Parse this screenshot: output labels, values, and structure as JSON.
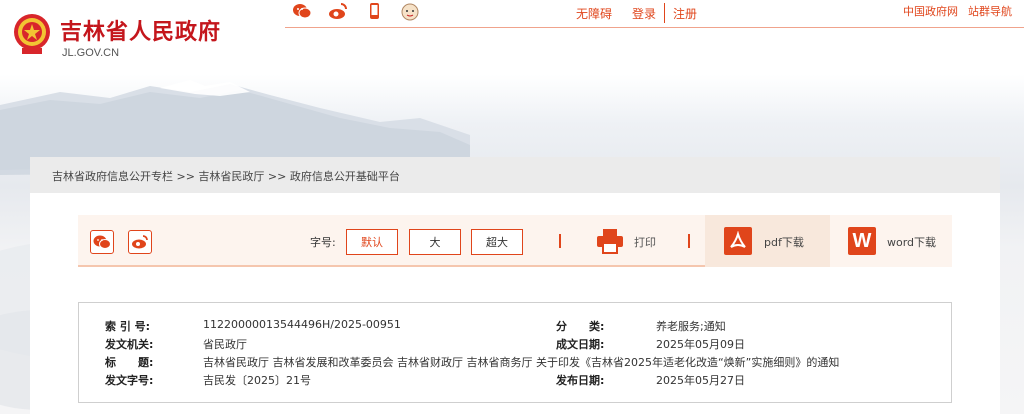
{
  "header": {
    "site_title": "吉林省人民政府",
    "site_domain": "JL.GOV.CN",
    "share_icons": [
      "wechat-icon",
      "weibo-icon",
      "mobile-icon",
      "mascot-icon"
    ],
    "accessibility": "无障碍",
    "login": "登录",
    "register": "注册",
    "china_gov": "中国政府网",
    "site_nav": "站群导航"
  },
  "breadcrumb": {
    "text": "吉林省政府信息公开专栏 >> 吉林省民政厅 >> 政府信息公开基础平台"
  },
  "toolbar": {
    "share_icons": [
      "wechat-icon",
      "weibo-icon"
    ],
    "font_size_label": "字号:",
    "font_default": "默认",
    "font_large": "大",
    "font_xlarge": "超大",
    "print": "打印",
    "pdf_download": "pdf下载",
    "word_download": "word下载"
  },
  "info": {
    "index_no_label": "索 引 号:",
    "index_no": "11220000013544496H/2025-00951",
    "category_label": "分　　类:",
    "category": "养老服务;通知",
    "issuer_label": "发文机关:",
    "issuer": "省民政厅",
    "created_label": "成文日期:",
    "created": "2025年05月09日",
    "title_label": "标　　题:",
    "title": "吉林省民政厅 吉林省发展和改革委员会 吉林省财政厅 吉林省商务厅 关于印发《吉林省2025年适老化改造“焕新”实施细则》的通知",
    "doc_no_label": "发文字号:",
    "doc_no": "吉民发〔2025〕21号",
    "published_label": "发布日期:",
    "published": "2025年05月27日"
  },
  "colors": {
    "accent": "#e0451b",
    "brand_red": "#c4161c"
  }
}
